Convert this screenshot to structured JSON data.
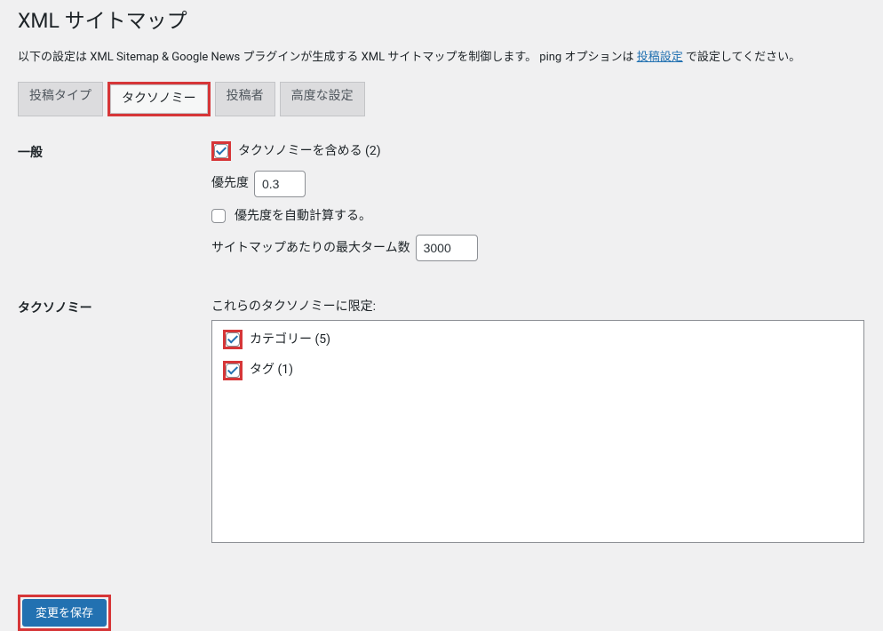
{
  "page": {
    "title": "XML サイトマップ",
    "desc_prefix": "以下の設定は XML Sitemap & Google News プラグインが生成する XML サイトマップを制御します。 ping オプションは ",
    "desc_link": "投稿設定",
    "desc_suffix": " で設定してください。"
  },
  "tabs": [
    {
      "id": "post-types",
      "label": "投稿タイプ",
      "active": false,
      "highlight": false
    },
    {
      "id": "taxonomies",
      "label": "タクソノミー",
      "active": true,
      "highlight": true
    },
    {
      "id": "authors",
      "label": "投稿者",
      "active": false,
      "highlight": false
    },
    {
      "id": "advanced",
      "label": "高度な設定",
      "active": false,
      "highlight": false
    }
  ],
  "general": {
    "heading": "一般",
    "include_taxonomies": {
      "label": "タクソノミーを含める (2)",
      "checked": true,
      "highlight": true
    },
    "priority": {
      "label": "優先度",
      "value": "0.3"
    },
    "auto_priority": {
      "label": "優先度を自動計算する。",
      "checked": false
    },
    "max_terms": {
      "label": "サイトマップあたりの最大ターム数",
      "value": "3000"
    }
  },
  "taxonomies": {
    "heading": "タクソノミー",
    "limit_label": "これらのタクソノミーに限定:",
    "items": [
      {
        "label": "カテゴリー (5)",
        "checked": true,
        "highlight": true
      },
      {
        "label": "タグ (1)",
        "checked": true,
        "highlight": true
      }
    ]
  },
  "submit": {
    "label": "変更を保存",
    "highlight": true
  }
}
